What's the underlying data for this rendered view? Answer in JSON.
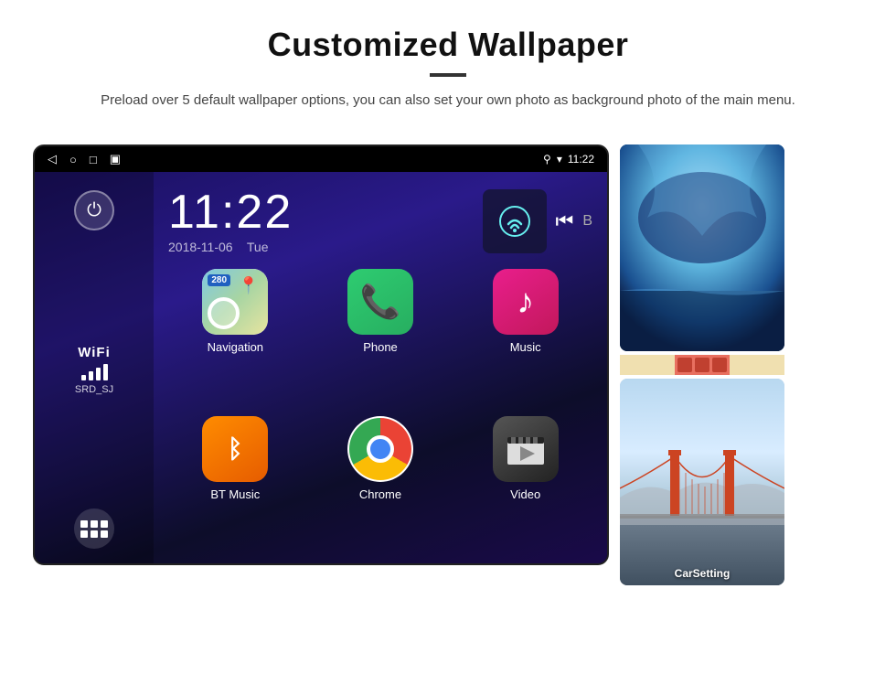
{
  "header": {
    "title": "Customized Wallpaper",
    "subtitle": "Preload over 5 default wallpaper options, you can also set your own photo as background photo of the main menu."
  },
  "device": {
    "statusBar": {
      "time": "11:22",
      "navIcons": [
        "◁",
        "○",
        "□",
        "▣"
      ]
    },
    "clock": {
      "time": "11:22",
      "date": "2018-11-06",
      "day": "Tue"
    },
    "wifi": {
      "label": "WiFi",
      "network": "SRD_SJ"
    },
    "apps": [
      {
        "name": "Navigation",
        "type": "navigation",
        "badge": "280"
      },
      {
        "name": "Phone",
        "type": "phone"
      },
      {
        "name": "Music",
        "type": "music"
      },
      {
        "name": "BT Music",
        "type": "bt"
      },
      {
        "name": "Chrome",
        "type": "chrome"
      },
      {
        "name": "Video",
        "type": "video"
      }
    ],
    "wallpapers": [
      {
        "type": "ice-cave",
        "label": ""
      },
      {
        "type": "golden-gate",
        "label": "CarSetting"
      }
    ]
  }
}
